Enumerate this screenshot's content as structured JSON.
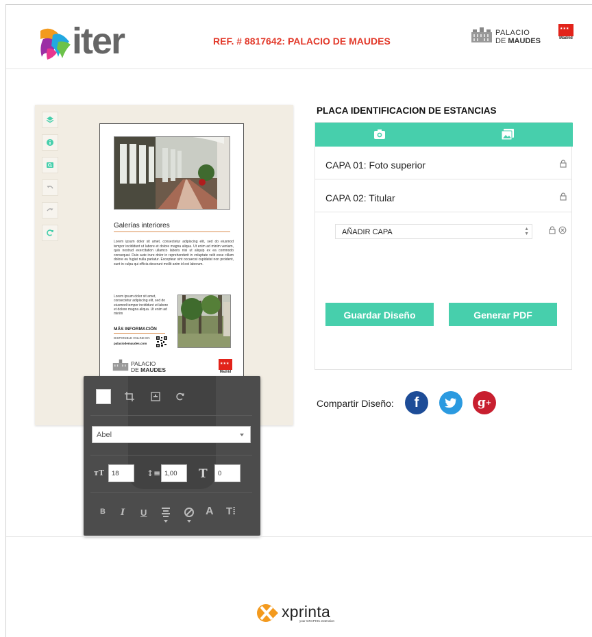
{
  "header": {
    "logo_text": "iter",
    "ref_title": "REF. # 8817642: PALACIO DE MAUDES",
    "partner_line1": "PALACIO",
    "partner_line2_pre": "DE ",
    "partner_line2_bold": "MAUDES",
    "region": "Madrid"
  },
  "editor": {
    "tools": [
      "layers-icon",
      "info-icon",
      "zoom-icon",
      "undo-icon",
      "redo-icon",
      "refresh-icon"
    ],
    "sheet": {
      "heading": "Galerías interiores",
      "body": "Lorem ipsum dolor sit amet, consectetur adipiscing elit, sed do eiusmod tempor incididunt ut labore et dolore magna aliqua. Ut enim ad minim veniam, quis nostrud exercitation ullamco laboris nisi ut aliquip ex ea commodo consequat. Duis aute irure dolor in reprehenderit in voluptate velit esse cillum dolore eu fugiat nulla pariatur. Excepteur sint occaecat cupidatat non proident, sunt in culpa qui officia deserunt mollit anim id est laborum.",
      "body_short": "Lorem ipsum dolor sit amet, consectetur adipiscing elit, sed do eiusmod tempor incididunt ut labore et dolore magna aliqua. Ut enim ad minim",
      "more_info": "MÁS INFORMACIÓN",
      "online_label": "DISPONIBLE ONLINE EN",
      "online_url": "palaciodemaudes.com",
      "brand_line1": "PALACIO",
      "brand_line2_pre": "DE ",
      "brand_line2_bold": "MAUDES",
      "region": "Madrid"
    }
  },
  "text_panel": {
    "font": "Abel",
    "font_size": "18",
    "line_height": "1,00",
    "letter_spacing": "0",
    "format_buttons": [
      "B",
      "I",
      "U"
    ]
  },
  "right": {
    "title": "PLACA IDENTIFICACION DE ESTANCIAS",
    "layers": [
      {
        "label": "CAPA 01: Foto superior"
      },
      {
        "label": "CAPA 02: Titular"
      }
    ],
    "add_layer_value": "AÑADIR CAPA",
    "save_label": "Guardar Diseño",
    "pdf_label": "Generar PDF",
    "share_label": "Compartir Diseño:",
    "social": [
      "facebook-icon",
      "twitter-icon",
      "google-plus-icon"
    ],
    "colors": {
      "accent": "#47cfac",
      "facebook": "#1d4c97",
      "twitter": "#2b9ae0",
      "google": "#c81f2f"
    }
  },
  "footer": {
    "brand": "xprinta",
    "tagline": "your GRAPHIC extension"
  }
}
